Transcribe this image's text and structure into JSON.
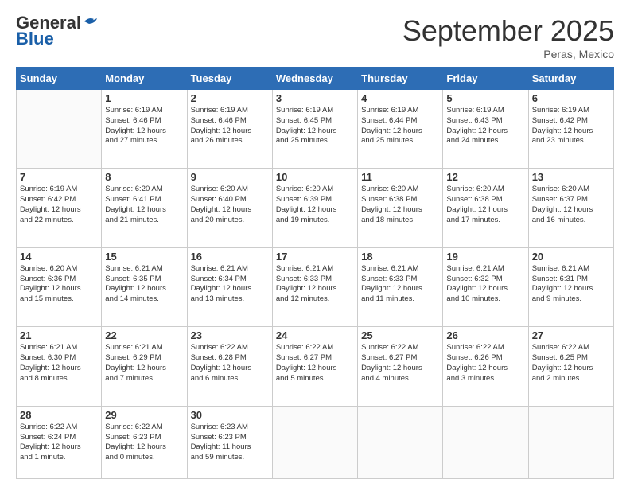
{
  "header": {
    "logo_general": "General",
    "logo_blue": "Blue",
    "month_title": "September 2025",
    "subtitle": "Peras, Mexico"
  },
  "days_of_week": [
    "Sunday",
    "Monday",
    "Tuesday",
    "Wednesday",
    "Thursday",
    "Friday",
    "Saturday"
  ],
  "weeks": [
    [
      {
        "num": "",
        "info": ""
      },
      {
        "num": "1",
        "info": "Sunrise: 6:19 AM\nSunset: 6:46 PM\nDaylight: 12 hours\nand 27 minutes."
      },
      {
        "num": "2",
        "info": "Sunrise: 6:19 AM\nSunset: 6:46 PM\nDaylight: 12 hours\nand 26 minutes."
      },
      {
        "num": "3",
        "info": "Sunrise: 6:19 AM\nSunset: 6:45 PM\nDaylight: 12 hours\nand 25 minutes."
      },
      {
        "num": "4",
        "info": "Sunrise: 6:19 AM\nSunset: 6:44 PM\nDaylight: 12 hours\nand 25 minutes."
      },
      {
        "num": "5",
        "info": "Sunrise: 6:19 AM\nSunset: 6:43 PM\nDaylight: 12 hours\nand 24 minutes."
      },
      {
        "num": "6",
        "info": "Sunrise: 6:19 AM\nSunset: 6:42 PM\nDaylight: 12 hours\nand 23 minutes."
      }
    ],
    [
      {
        "num": "7",
        "info": "Sunrise: 6:19 AM\nSunset: 6:42 PM\nDaylight: 12 hours\nand 22 minutes."
      },
      {
        "num": "8",
        "info": "Sunrise: 6:20 AM\nSunset: 6:41 PM\nDaylight: 12 hours\nand 21 minutes."
      },
      {
        "num": "9",
        "info": "Sunrise: 6:20 AM\nSunset: 6:40 PM\nDaylight: 12 hours\nand 20 minutes."
      },
      {
        "num": "10",
        "info": "Sunrise: 6:20 AM\nSunset: 6:39 PM\nDaylight: 12 hours\nand 19 minutes."
      },
      {
        "num": "11",
        "info": "Sunrise: 6:20 AM\nSunset: 6:38 PM\nDaylight: 12 hours\nand 18 minutes."
      },
      {
        "num": "12",
        "info": "Sunrise: 6:20 AM\nSunset: 6:38 PM\nDaylight: 12 hours\nand 17 minutes."
      },
      {
        "num": "13",
        "info": "Sunrise: 6:20 AM\nSunset: 6:37 PM\nDaylight: 12 hours\nand 16 minutes."
      }
    ],
    [
      {
        "num": "14",
        "info": "Sunrise: 6:20 AM\nSunset: 6:36 PM\nDaylight: 12 hours\nand 15 minutes."
      },
      {
        "num": "15",
        "info": "Sunrise: 6:21 AM\nSunset: 6:35 PM\nDaylight: 12 hours\nand 14 minutes."
      },
      {
        "num": "16",
        "info": "Sunrise: 6:21 AM\nSunset: 6:34 PM\nDaylight: 12 hours\nand 13 minutes."
      },
      {
        "num": "17",
        "info": "Sunrise: 6:21 AM\nSunset: 6:33 PM\nDaylight: 12 hours\nand 12 minutes."
      },
      {
        "num": "18",
        "info": "Sunrise: 6:21 AM\nSunset: 6:33 PM\nDaylight: 12 hours\nand 11 minutes."
      },
      {
        "num": "19",
        "info": "Sunrise: 6:21 AM\nSunset: 6:32 PM\nDaylight: 12 hours\nand 10 minutes."
      },
      {
        "num": "20",
        "info": "Sunrise: 6:21 AM\nSunset: 6:31 PM\nDaylight: 12 hours\nand 9 minutes."
      }
    ],
    [
      {
        "num": "21",
        "info": "Sunrise: 6:21 AM\nSunset: 6:30 PM\nDaylight: 12 hours\nand 8 minutes."
      },
      {
        "num": "22",
        "info": "Sunrise: 6:21 AM\nSunset: 6:29 PM\nDaylight: 12 hours\nand 7 minutes."
      },
      {
        "num": "23",
        "info": "Sunrise: 6:22 AM\nSunset: 6:28 PM\nDaylight: 12 hours\nand 6 minutes."
      },
      {
        "num": "24",
        "info": "Sunrise: 6:22 AM\nSunset: 6:27 PM\nDaylight: 12 hours\nand 5 minutes."
      },
      {
        "num": "25",
        "info": "Sunrise: 6:22 AM\nSunset: 6:27 PM\nDaylight: 12 hours\nand 4 minutes."
      },
      {
        "num": "26",
        "info": "Sunrise: 6:22 AM\nSunset: 6:26 PM\nDaylight: 12 hours\nand 3 minutes."
      },
      {
        "num": "27",
        "info": "Sunrise: 6:22 AM\nSunset: 6:25 PM\nDaylight: 12 hours\nand 2 minutes."
      }
    ],
    [
      {
        "num": "28",
        "info": "Sunrise: 6:22 AM\nSunset: 6:24 PM\nDaylight: 12 hours\nand 1 minute."
      },
      {
        "num": "29",
        "info": "Sunrise: 6:22 AM\nSunset: 6:23 PM\nDaylight: 12 hours\nand 0 minutes."
      },
      {
        "num": "30",
        "info": "Sunrise: 6:23 AM\nSunset: 6:23 PM\nDaylight: 11 hours\nand 59 minutes."
      },
      {
        "num": "",
        "info": ""
      },
      {
        "num": "",
        "info": ""
      },
      {
        "num": "",
        "info": ""
      },
      {
        "num": "",
        "info": ""
      }
    ]
  ]
}
